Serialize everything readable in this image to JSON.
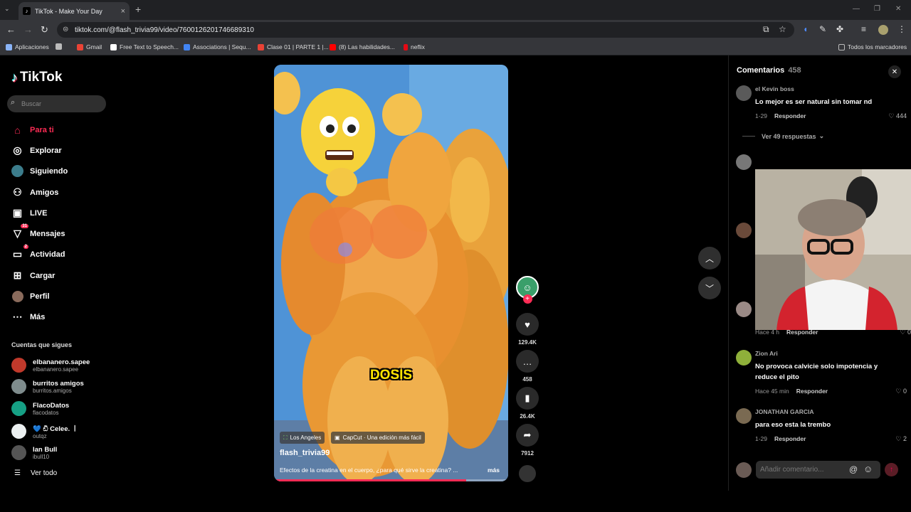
{
  "browser": {
    "tab_title": "TikTok - Make Your Day",
    "url": "tiktok.com/@flash_trivia99/video/7600126201746689310",
    "bookmarks": [
      {
        "label": "Aplicaciones",
        "color": "#8ab4f8"
      },
      {
        "label": "Gmail",
        "color": "#ea4335"
      },
      {
        "label": "Free Text to Speech...",
        "color": "#ffffff"
      },
      {
        "label": "Associations | Sequ...",
        "color": "#4285f4"
      },
      {
        "label": "Clase 01 | PARTE 1 |...",
        "color": "#e94235"
      },
      {
        "label": "(8) Las habilidades...",
        "color": "#ff0000"
      },
      {
        "label": "neflix",
        "color": "#e50914"
      }
    ],
    "all_bookmarks_label": "Todos los marcadores"
  },
  "sidebar": {
    "logo_text": "TikTok",
    "search_placeholder": "Buscar",
    "menu": [
      {
        "label": "Para ti",
        "icon": "home-icon",
        "active": true
      },
      {
        "label": "Explorar",
        "icon": "compass-icon"
      },
      {
        "label": "Siguiendo",
        "icon": "following-icon"
      },
      {
        "label": "Amigos",
        "icon": "friends-icon"
      },
      {
        "label": "LIVE",
        "icon": "live-icon"
      },
      {
        "label": "Mensajes",
        "icon": "messages-icon",
        "badge": "31"
      },
      {
        "label": "Actividad",
        "icon": "activity-icon",
        "badge": "2"
      },
      {
        "label": "Cargar",
        "icon": "upload-icon"
      },
      {
        "label": "Perfil",
        "icon": "profile-icon"
      },
      {
        "label": "Más",
        "icon": "more-icon"
      }
    ],
    "following_title": "Cuentas que sigues",
    "accounts": [
      {
        "name": "elbananero.sapee",
        "handle": "elbananero.sapee",
        "color": "#c0392b"
      },
      {
        "name": "burritos amigos",
        "handle": "burritos.amigos",
        "color": "#7f8c8d"
      },
      {
        "name": "FlacoDatos",
        "handle": "flacodatos",
        "color": "#16a085"
      },
      {
        "name": "💙 ඩි Celee. ㅣ",
        "handle": "outqz",
        "color": "#ecf0f1"
      },
      {
        "name": "Ian Bull",
        "handle": "ibull10",
        "color": "#555555"
      }
    ],
    "see_all": "Ver todo"
  },
  "video": {
    "caption_word": "DOSIS",
    "location_tag": "Los Angeles",
    "capcut_tag": "CapCut · Una edición más fácil",
    "username": "flash_trivia99",
    "description": "Efectos de la creatina en el cuerpo, ¿para qué sirve la creatina? ...",
    "more": "más",
    "progress": 0.82
  },
  "actions": {
    "likes": "129.4K",
    "comments": "458",
    "saves": "26.4K",
    "shares": "7912"
  },
  "comments_panel": {
    "title": "Comentarios",
    "count": "458",
    "view_replies": "Ver 49 respuestas",
    "items": [
      {
        "user": "el Kevin boss",
        "text": "Lo mejor es ser natural sin tomar nd",
        "time": "1-29",
        "reply": "Responder",
        "likes": "444"
      },
      {
        "user": "Zion Ari",
        "text": "No provoca calvicie solo impotencia y reduce el pito",
        "time": "Hace 45 min",
        "reply": "Responder",
        "likes": "0"
      },
      {
        "user": "JONATHAN GARCIA",
        "text": "para eso esta la trembo",
        "time": "1-29",
        "reply": "Responder",
        "likes": "2"
      }
    ],
    "partial_meta": {
      "time": "Hace 4 h",
      "reply": "Responder",
      "likes": "0"
    },
    "input_placeholder": "Añadir comentario..."
  }
}
